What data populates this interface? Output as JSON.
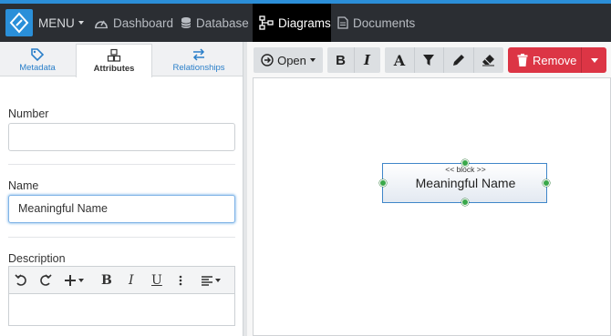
{
  "navbar": {
    "menu_label": "MENU",
    "items": [
      {
        "label": "Dashboard",
        "icon": "dashboard-icon"
      },
      {
        "label": "Database",
        "icon": "database-icon"
      },
      {
        "label": "Diagrams",
        "icon": "diagram-icon",
        "active": true
      },
      {
        "label": "Documents",
        "icon": "document-icon"
      }
    ],
    "accent": "#2b8ed8",
    "bg": "#2b2e33"
  },
  "left_panel": {
    "tabs": [
      {
        "label": "Metadata",
        "icon": "tag-icon"
      },
      {
        "label": "Attributes",
        "icon": "cubes-icon",
        "active": true
      },
      {
        "label": "Relationships",
        "icon": "exchange-icon"
      }
    ],
    "fields": {
      "number": {
        "label": "Number",
        "value": ""
      },
      "name": {
        "label": "Name",
        "value": "Meaningful Name"
      },
      "description": {
        "label": "Description",
        "value": ""
      }
    },
    "editor_toolbar": [
      "undo-icon",
      "redo-icon",
      "insert-plus-icon",
      "bold-icon",
      "italic-icon",
      "underline-icon",
      "more-vertical-icon",
      "align-left-icon"
    ]
  },
  "right_panel": {
    "toolbar": {
      "open_label": "Open",
      "remove_label": "Remove",
      "buttons": [
        "bold-icon",
        "italic-icon",
        "font-icon",
        "filter-icon",
        "pencil-icon",
        "eraser-icon"
      ],
      "remove_color": "#dc3545"
    },
    "diagram": {
      "block": {
        "stereotype": "<< block >>",
        "name": "Meaningful Name"
      }
    }
  }
}
